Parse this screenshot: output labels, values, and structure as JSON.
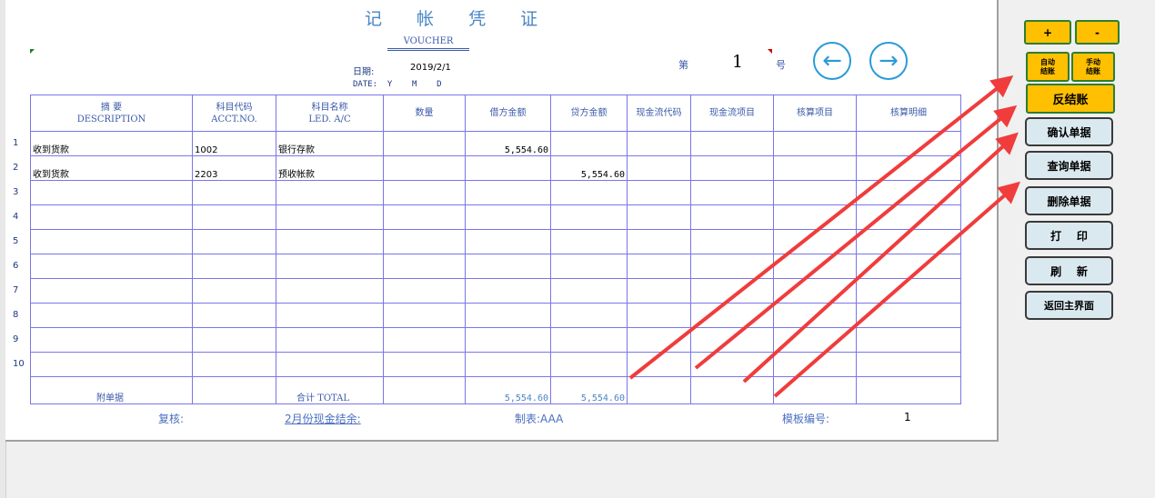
{
  "voucher": {
    "title": "记 帐 凭 证",
    "subtitle": "VOUCHER",
    "date_label": "日期:",
    "date_value": "2019/2/1",
    "date_en": "DATE:  Y    M    D",
    "num_prefix": "第",
    "num_value": "1",
    "num_suffix": "号"
  },
  "columns": [
    {
      "cn": "摘      要",
      "en": "DESCRIPTION"
    },
    {
      "cn": "科目代码",
      "en": "ACCT.NO."
    },
    {
      "cn": "科目名称",
      "en": "LED. A/C"
    },
    {
      "cn": "数量",
      "en": ""
    },
    {
      "cn": "借方金额",
      "en": ""
    },
    {
      "cn": "贷方金额",
      "en": ""
    },
    {
      "cn": "现金流代码",
      "en": ""
    },
    {
      "cn": "现金流项目",
      "en": ""
    },
    {
      "cn": "核算项目",
      "en": ""
    },
    {
      "cn": "核算明细",
      "en": ""
    }
  ],
  "rows": [
    {
      "n": "1",
      "desc": "收到货款",
      "code": "1002",
      "name": "银行存款",
      "debit": "5,554.60",
      "credit": ""
    },
    {
      "n": "2",
      "desc": "收到货款",
      "code": "2203",
      "name": "预收帐款",
      "debit": "",
      "credit": "5,554.60"
    },
    {
      "n": "3",
      "desc": "",
      "code": "",
      "name": "",
      "debit": "",
      "credit": ""
    },
    {
      "n": "4",
      "desc": "",
      "code": "",
      "name": "",
      "debit": "",
      "credit": ""
    },
    {
      "n": "5",
      "desc": "",
      "code": "",
      "name": "",
      "debit": "",
      "credit": ""
    },
    {
      "n": "6",
      "desc": "",
      "code": "",
      "name": "",
      "debit": "",
      "credit": ""
    },
    {
      "n": "7",
      "desc": "",
      "code": "",
      "name": "",
      "debit": "",
      "credit": ""
    },
    {
      "n": "8",
      "desc": "",
      "code": "",
      "name": "",
      "debit": "",
      "credit": ""
    },
    {
      "n": "9",
      "desc": "",
      "code": "",
      "name": "",
      "debit": "",
      "credit": ""
    },
    {
      "n": "10",
      "desc": "",
      "code": "",
      "name": "",
      "debit": "",
      "credit": ""
    }
  ],
  "totals": {
    "attach_label": "附单据",
    "total_label": "合计   TOTAL",
    "debit_total": "5,554.60",
    "credit_total": "5,554.60"
  },
  "footer": {
    "review": "复核:",
    "cash_balance": "2月份现金结余:",
    "maker": "制表:AAA",
    "template_label": "模板编号:",
    "template_value": "1"
  },
  "buttons": {
    "plus": "+",
    "minus": "-",
    "auto_close": "自动\n结账",
    "manual_close": "手动\n结账",
    "reverse_close": "反结账",
    "confirm": "确认单据",
    "query": "查询单据",
    "delete": "删除单据",
    "print": "打    印",
    "refresh": "刷    新",
    "back": "返回主界面"
  },
  "icons": {
    "prev": "arrow-left-icon",
    "next": "arrow-right-icon"
  },
  "colors": {
    "accent_gold": "#fec000",
    "arrow_red": "#f03c3c",
    "grid_blue": "#7a76e6"
  }
}
